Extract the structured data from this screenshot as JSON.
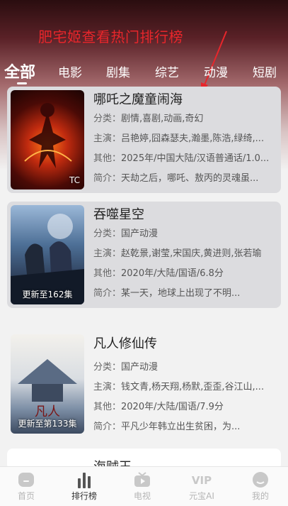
{
  "annotation": {
    "text": "肥宅姬查看热门排行榜"
  },
  "tabs": [
    {
      "label": "全部",
      "active": true
    },
    {
      "label": "电影"
    },
    {
      "label": "剧集"
    },
    {
      "label": "综艺"
    },
    {
      "label": "动漫"
    },
    {
      "label": "短剧"
    }
  ],
  "items": [
    {
      "title": "哪吒之魔童闹海",
      "badge": "TC",
      "category_label": "分类：",
      "category": "剧情,喜剧,动画,奇幻",
      "cast_label": "主演：",
      "cast": "吕艳婷,囧森瑟夫,瀚墨,陈浩,绿绮,...",
      "other_label": "其他：",
      "other": "2025年/中国大陆/汉语普通话/1.0...",
      "intro_label": "简介：",
      "intro": "天劫之后，哪吒、敖丙的灵魂虽..."
    },
    {
      "title": "吞噬星空",
      "badge": "更新至162集",
      "category_label": "分类：",
      "category": "国产动漫",
      "cast_label": "主演：",
      "cast": "赵乾景,谢莹,宋国庆,黄进则,张若瑜",
      "other_label": "其他：",
      "other": "2020年/大陆/国语/6.8分",
      "intro_label": "简介：",
      "intro": "某一天，地球上出现了不明..."
    },
    {
      "title": "凡人修仙传",
      "badge": "更新至第133集",
      "category_label": "分类：",
      "category": "国产动漫",
      "cast_label": "主演：",
      "cast": "钱文青,杨天翔,杨默,歪歪,谷江山,...",
      "other_label": "其他：",
      "other": "2020年/大陆/国语/7.9分",
      "intro_label": "简介：",
      "intro": "平凡少年韩立出生贫困，为..."
    },
    {
      "title": "海贼王"
    }
  ],
  "nav": [
    {
      "label": "首页",
      "icon": "home-icon"
    },
    {
      "label": "排行榜",
      "icon": "ranking-icon",
      "active": true
    },
    {
      "label": "电视",
      "icon": "tv-icon"
    },
    {
      "label": "元宝AI",
      "icon": "vip-icon",
      "icon_text": "VIP"
    },
    {
      "label": "我的",
      "icon": "profile-icon"
    }
  ],
  "colors": {
    "annotation": "#e8262b",
    "highlight_card": "#dcdcdf"
  }
}
